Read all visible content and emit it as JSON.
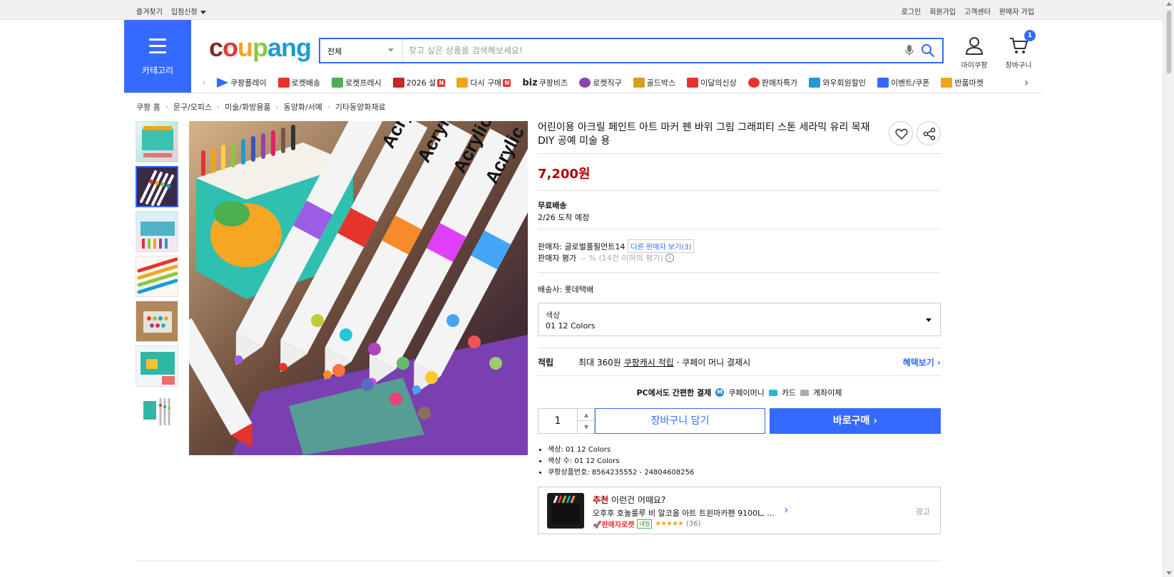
{
  "topbar": {
    "left": [
      "즐겨찾기",
      "입점신청"
    ],
    "right": [
      "로그인",
      "회원가입",
      "고객센터",
      "판매자 가입"
    ]
  },
  "header": {
    "category_label": "카테고리",
    "logo_text": [
      "c",
      "o",
      "u",
      "p",
      "ang"
    ],
    "search_scope": "전체",
    "search_placeholder": "찾고 싶은 상품을 검색해보세요!",
    "mypage_label": "마이쿠팡",
    "cart_label": "장바구니",
    "cart_count": "1"
  },
  "nav": [
    {
      "label": "쿠팡플레이",
      "color": "#346aff",
      "new": false
    },
    {
      "label": "로켓배송",
      "color": "#e6342c",
      "new": false
    },
    {
      "label": "로켓프레시",
      "color": "#4caf50",
      "new": false
    },
    {
      "label": "2026 설",
      "color": "#c62828",
      "new": true
    },
    {
      "label": "다시 구매",
      "color": "#f2a51c",
      "new": true
    },
    {
      "label": "쿠팡비즈",
      "color": "#444444",
      "new": false,
      "prefix": "biz"
    },
    {
      "label": "로켓직구",
      "color": "#8e44ad",
      "new": false
    },
    {
      "label": "골드박스",
      "color": "#d4a017",
      "new": false
    },
    {
      "label": "이달의신상",
      "color": "#e6342c",
      "new": false
    },
    {
      "label": "판매자특가",
      "color": "#e6342c",
      "new": false
    },
    {
      "label": "와우회원할인",
      "color": "#1c9bd6",
      "new": false
    },
    {
      "label": "이벤트/쿠폰",
      "color": "#346aff",
      "new": false
    },
    {
      "label": "반품마켓",
      "color": "#f2a51c",
      "new": false
    }
  ],
  "breadcrumb": [
    "쿠팡 홈",
    "문구/오피스",
    "미술/화방용품",
    "동양화/서예",
    "기타동양화재료"
  ],
  "product": {
    "title": "어린이용 아크릴 페인트 아트 마커 펜 바위 그림 그래피티 스톤 세라믹 유리 목재 DIY 공예 미술 용",
    "price": "7,200원",
    "shipping_type": "무료배송",
    "shipping_eta": "2/26 도착 예정",
    "seller_label": "판매자: 글로벌풀필먼트14",
    "other_sellers": "다른 판매자 보기(3)",
    "seller_rating_label": "판매자 평가",
    "seller_rating_value": "-- % (14건 이하의 평가)",
    "carrier": "배송사: 롯데택배",
    "option_label": "색상",
    "option_value": "01 12 Colors",
    "reward_title": "적립",
    "reward_prefix": "최대 360원",
    "reward_link": "쿠팡캐시 적립",
    "reward_suffix": "· 쿠페이 머니 결제시",
    "reward_more": "혜택보기",
    "pay_title": "PC에서도 간편한 결제",
    "pay_methods": [
      "쿠페이머니",
      "카드",
      "계좌이체"
    ],
    "quantity": "1",
    "cart_button": "장바구니 담기",
    "buy_button": "바로구매",
    "specs": [
      "색상: 01 12 Colors",
      "색상 수: 01 12 Colors",
      "쿠팡상품번호: 8564235552 - 24804608256"
    ]
  },
  "recommend": {
    "head_red": "추천",
    "head_rest": "이런건 어때요?",
    "name": "오후후 호놀룰루 비 알코올 아트 트윈마카펜 9100L, ...",
    "badge": "판매자로켓",
    "badge_day": "내일",
    "stars": "★★★★★",
    "count": "(36)",
    "ad": "광고"
  },
  "colors": {
    "brand_blue": "#346aff",
    "price_red": "#ae0000"
  },
  "icons": [
    "menu-icon",
    "search-icon",
    "mic-icon",
    "user-icon",
    "cart-icon",
    "heart-icon",
    "share-icon",
    "chevron-right-icon"
  ]
}
